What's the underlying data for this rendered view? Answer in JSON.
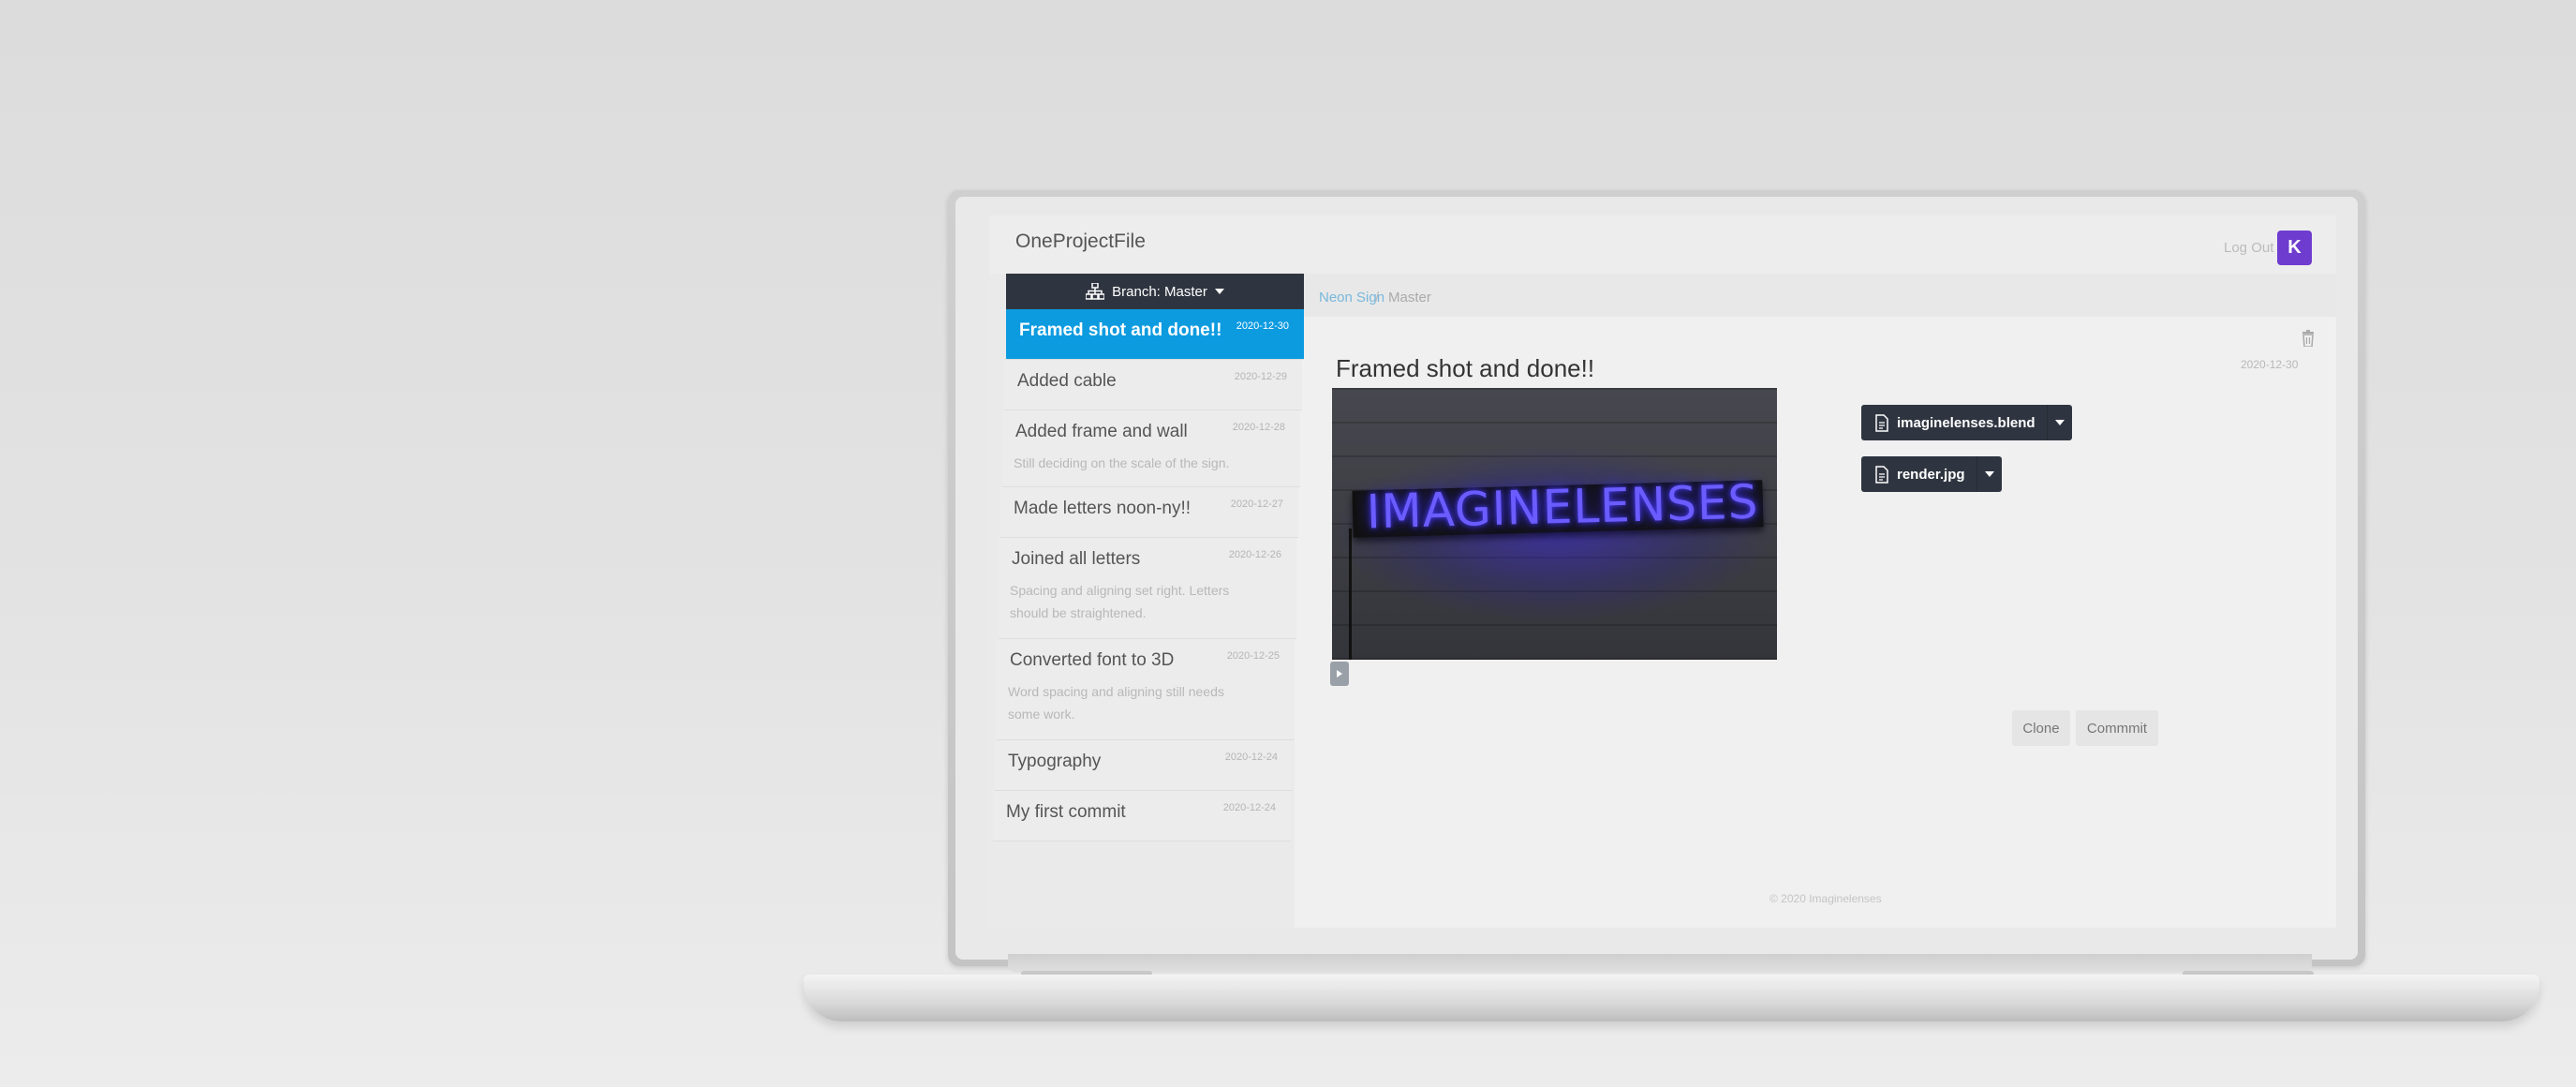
{
  "app": {
    "name": "OneProjectFile",
    "logout_label": "Log Out",
    "avatar_initial": "K",
    "footer": "© 2020 Imaginelenses"
  },
  "branch": {
    "label": "Branch: Master"
  },
  "breadcrumb": {
    "project": "Neon Sign",
    "separator": "/",
    "branch": "Master"
  },
  "commits": [
    {
      "title": "Framed shot and done!!",
      "date": "2020-12-30",
      "desc": "",
      "active": true
    },
    {
      "title": "Added cable",
      "date": "2020-12-29",
      "desc": ""
    },
    {
      "title": "Added frame and wall",
      "date": "2020-12-28",
      "desc": "Still deciding on the scale of the sign."
    },
    {
      "title": "Made letters noon-ny!!",
      "date": "2020-12-27",
      "desc": ""
    },
    {
      "title": "Joined all letters",
      "date": "2020-12-26",
      "desc": "Spacing and aligning set right. Letters should be straightened."
    },
    {
      "title": "Converted font to 3D",
      "date": "2020-12-25",
      "desc": "Word spacing and aligning still needs some work."
    },
    {
      "title": "Typography",
      "date": "2020-12-24",
      "desc": ""
    },
    {
      "title": "My first commit",
      "date": "2020-12-24",
      "desc": ""
    }
  ],
  "detail": {
    "title": "Framed shot and done!!",
    "date": "2020-12-30",
    "render_text": "IMAGINELENSES",
    "files": [
      {
        "name": "imaginelenses.blend"
      },
      {
        "name": "render.jpg"
      }
    ],
    "clone_label": "Clone",
    "commit_label": "Commmit"
  },
  "colors": {
    "accent": "#0d9be0",
    "dark": "#2f3540",
    "avatar": "#6e3ccf",
    "link": "#78b8dc"
  }
}
